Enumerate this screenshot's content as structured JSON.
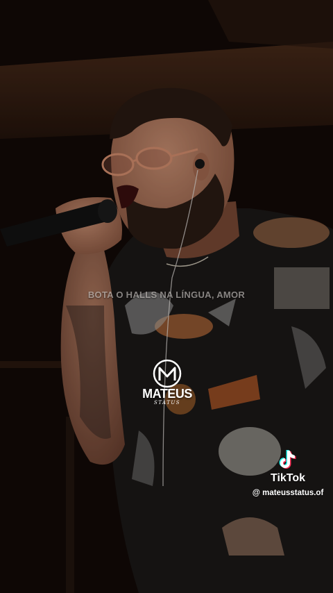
{
  "caption": {
    "text": "BOTA O HALLS NA LÍNGUA, AMOR"
  },
  "watermark": {
    "name": "MATEUS",
    "sub": "STATUS",
    "icon": "m-logo-icon"
  },
  "tiktok": {
    "brand": "TikTok",
    "handle": "@ mateusstatus.of",
    "icon": "tiktok-note-icon"
  }
}
